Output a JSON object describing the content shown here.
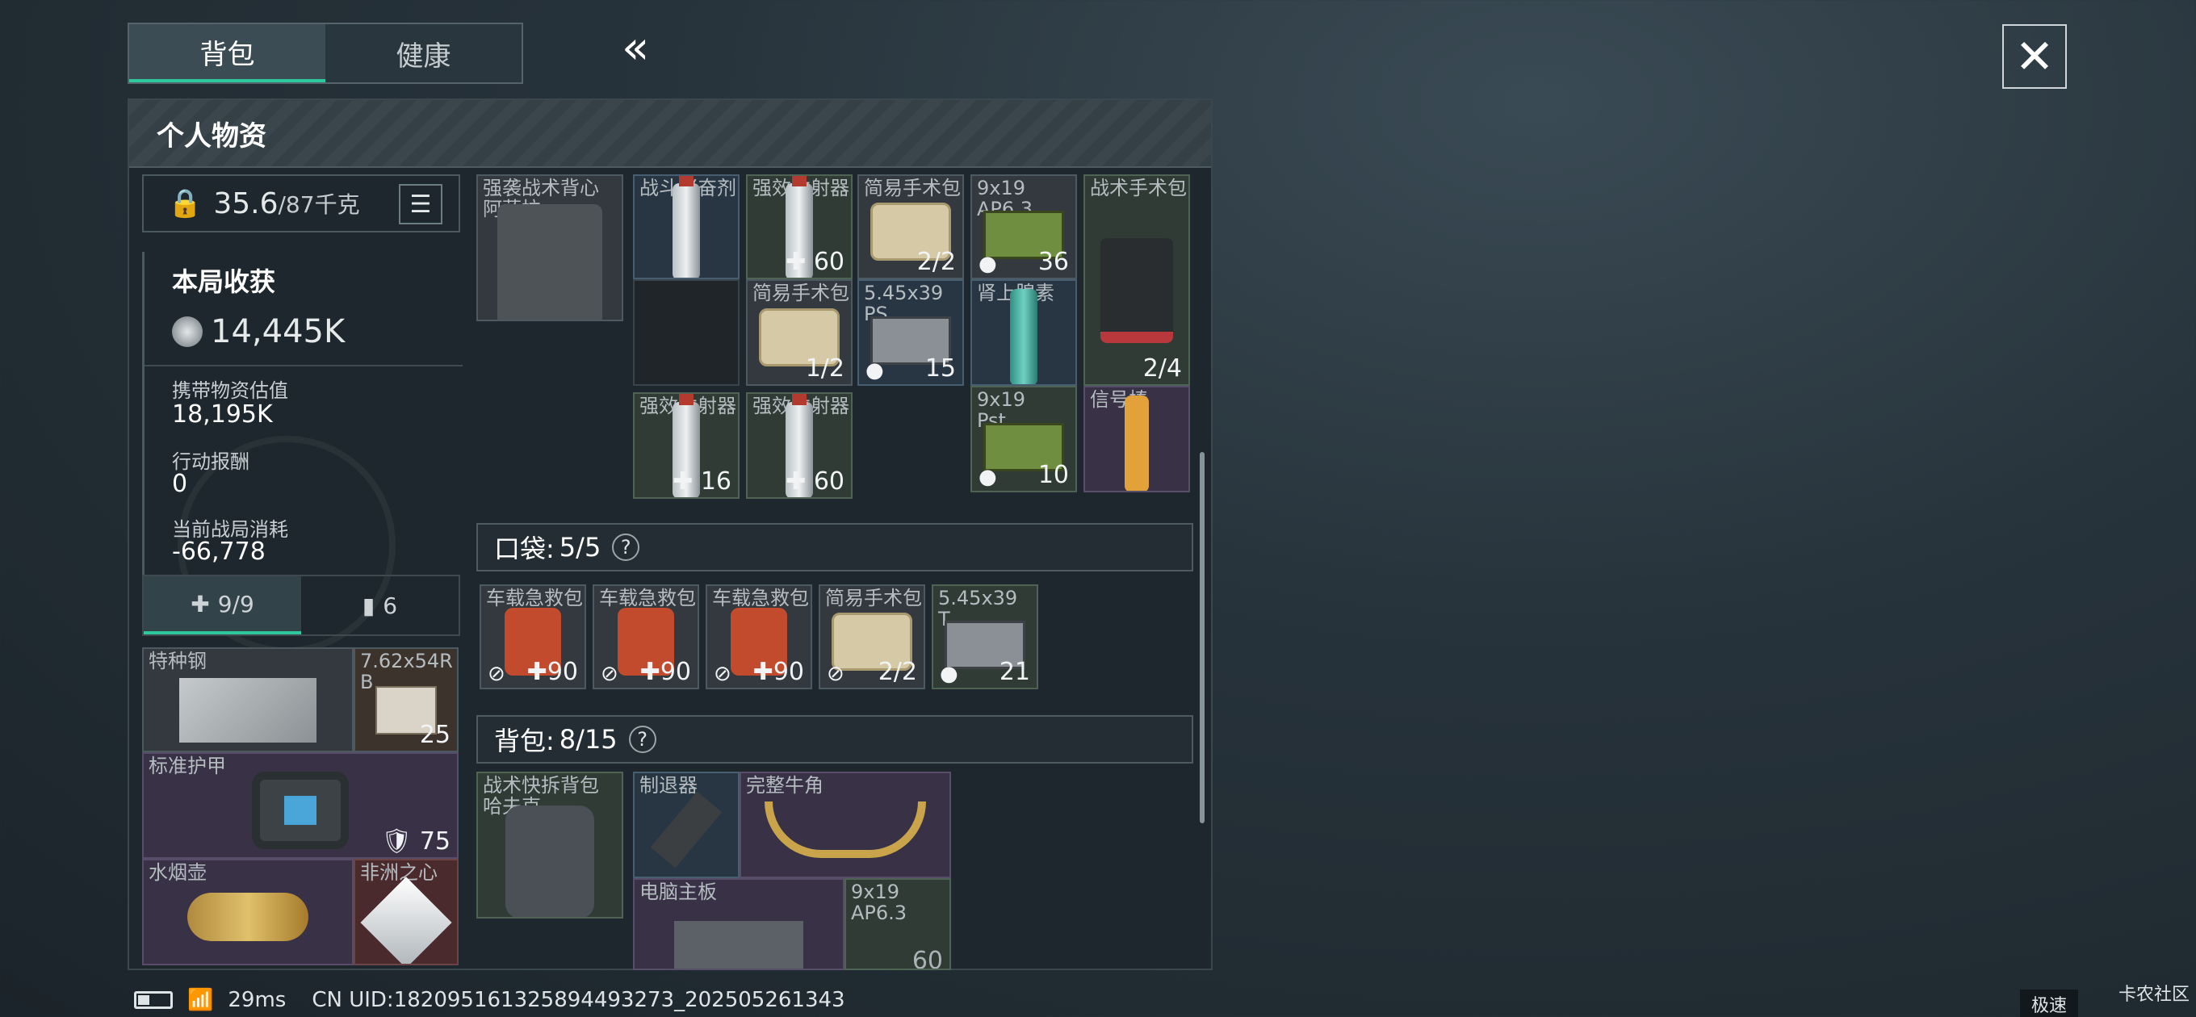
{
  "tabs": [
    {
      "label": "背包"
    },
    {
      "label": "健康"
    }
  ],
  "collapse_glyph": "«",
  "close_glyph": "✕",
  "panel_title": "个人物资",
  "weight": {
    "current": "35.6",
    "max": "/87千克"
  },
  "stats": {
    "title": "本局收获",
    "total": "14,445K",
    "rows": [
      {
        "label": "携带物资估值",
        "value": "18,195K"
      },
      {
        "label": "行动报酬",
        "value": "0"
      },
      {
        "label": "当前战局消耗",
        "value": "-66,778"
      }
    ]
  },
  "sub_tabs": [
    {
      "label": "9/9",
      "icon": "medkit-icon"
    },
    {
      "label": "6",
      "icon": "ammo-icon"
    }
  ],
  "left_items": [
    {
      "name": "特种钢"
    },
    {
      "name": "7.62x54R",
      "sub": "B",
      "count": "25"
    },
    {
      "name": "标准护甲",
      "count": "75"
    },
    {
      "name": "水烟壶"
    },
    {
      "name": "非洲之心"
    }
  ],
  "vest": {
    "name": "强袭战术背心",
    "sub": "阿萨拉"
  },
  "vest_items": [
    {
      "name": "战斗兴奋剂"
    },
    {
      "name": "强效注射器",
      "count": "60"
    },
    {
      "name": "简易手术包",
      "count": "2/2"
    },
    {
      "name": "9x19",
      "sub": "AP6.3",
      "count": "36"
    },
    {
      "name": "战术手术包",
      "count": "2/4"
    },
    {
      "name": "简易手术包",
      "count": "1/2"
    },
    {
      "name": "5.45x39",
      "sub": "PS",
      "count": "15"
    },
    {
      "name": "肾上腺素"
    },
    {
      "name": "强效注射器",
      "count": "16"
    },
    {
      "name": "强效注射器",
      "count": "60"
    },
    {
      "name": "9x19",
      "sub": "Pst",
      "count": "10"
    },
    {
      "name": "信号棒"
    }
  ],
  "pocket": {
    "title": "口袋:",
    "count": "5/5",
    "help": "?"
  },
  "pocket_items": [
    {
      "name": "车载急救包",
      "count": "90"
    },
    {
      "name": "车载急救包",
      "count": "90"
    },
    {
      "name": "车载急救包",
      "count": "90"
    },
    {
      "name": "简易手术包",
      "count": "2/2"
    },
    {
      "name": "5.45x39",
      "sub": "T",
      "count": "21"
    }
  ],
  "backpack": {
    "title": "背包:",
    "count": "8/15",
    "help": "?"
  },
  "pack": {
    "name": "战术快拆背包",
    "sub": "哈夫克"
  },
  "pack_items": [
    {
      "name": "制退器"
    },
    {
      "name": "完整牛角"
    },
    {
      "name": "电脑主板"
    },
    {
      "name": "9x19",
      "sub": "AP6.3",
      "count": "60"
    }
  ],
  "status": {
    "ping": "29ms",
    "uid": "CN UID:182095161325894493273_202505261343"
  },
  "speed_label": "极速",
  "watermark": "卡农社区"
}
